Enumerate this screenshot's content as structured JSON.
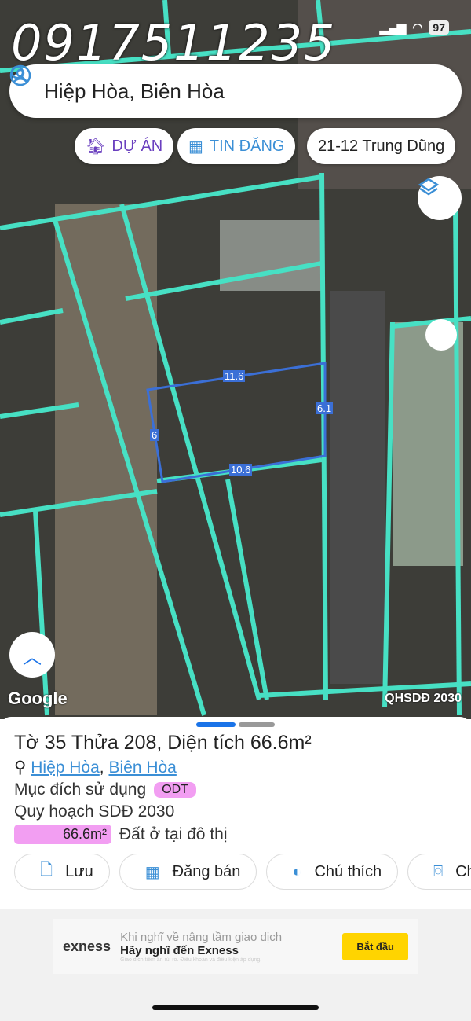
{
  "watermark": "0917511235",
  "status": {
    "battery": "97"
  },
  "search": {
    "value": "Hiệp Hòa, Biên Hòa"
  },
  "chips": [
    {
      "label": "DỰ ÁN",
      "color": "#6a3fbf"
    },
    {
      "label": "TIN ĐĂNG",
      "color": "#3b8fd6"
    },
    {
      "label": "21-12 Trung Dũng"
    }
  ],
  "map": {
    "edges": [
      "11.6",
      "6.1",
      "6",
      "10.6"
    ],
    "google": "Google",
    "layer_label": "QHSDĐ 2030",
    "boundary_color": "#47e0c4",
    "plot_color": "#3b6fd6"
  },
  "sheet": {
    "title": "Tờ 35 Thửa 208, Diện tích 66.6m²",
    "ward": "Hiệp Hòa",
    "city": "Biên Hòa",
    "purpose_label": "Mục đích sử dụng",
    "purpose_code": "ODT",
    "plan": "Quy hoạch SDĐ 2030",
    "area": "66.6m²",
    "area_desc": "Đất ở tại đô thị",
    "buttons": [
      "Lưu",
      "Đăng bán",
      "Chú thích",
      "Ch"
    ]
  },
  "ad": {
    "brand": "exness",
    "line1": "Khi nghĩ về nâng tầm giao dịch",
    "line2": "Hãy nghĩ đến Exness",
    "disclaimer": "Giao dịch tiềm ẩn rủi ro. Điều khoản và điều kiện áp dụng.",
    "cta": "Bắt đầu"
  }
}
